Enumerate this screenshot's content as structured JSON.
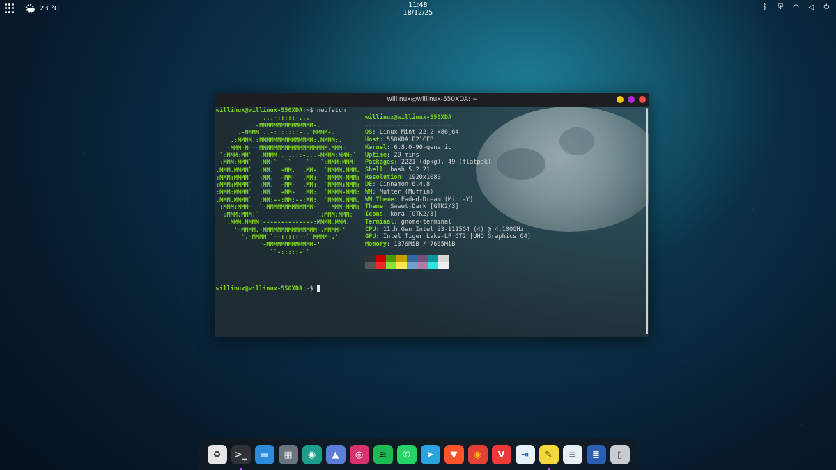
{
  "topbar": {
    "weather": {
      "icon": "partly-cloudy-icon",
      "temperature": "23 °C"
    },
    "clock": {
      "time": "11:48",
      "date": "18/12/25"
    },
    "tray": [
      {
        "name": "bluetooth-icon",
        "glyph": "ᛒ"
      },
      {
        "name": "shield-icon",
        "glyph": "⛨"
      },
      {
        "name": "wifi-icon",
        "glyph": "◠"
      },
      {
        "name": "volume-icon",
        "glyph": "◁"
      },
      {
        "name": "power-icon",
        "glyph": "⏻"
      }
    ]
  },
  "terminal": {
    "title": "willinux@willinux-550XDA: ~",
    "prompt_user": "willinux@willinux-550XDA",
    "prompt_suffix": ":~$ ",
    "command": "neofetch",
    "ascii_art": [
      "             ...-:::::-...",
      "          .-MMMMMMMMMMMMMMM-.",
      "      .-MMMM`..-:::::::-..`MMMM-.",
      "    .:MMMM.:MMMMMMMMMMMMMMM:.MMMM:.",
      "   -MMM-M---MMMMMMMMMMMMMMMMMMM.MMM-",
      " `:MMM:MM`  :MMMM:....::-...-MMMM:MMM:`",
      " :MMM:MMM`  :MM:`  ``    ``  `:MMM:MMM:",
      ".MMM.MMMM`  :MM.  -MM.  .MM-  `MMMM.MMM.",
      ":MMM:MMMM`  :MM.  -MM-  .MM:  `MMMM-MMM:",
      ":MMM:MMMM`  :MM.  -MM-  .MM:  `MMMM:MMM:",
      ":MMM:MMMM`  :MM.  -MM-  .MM:  `MMMM-MMM:",
      ".MMM.MMMM`  :MM:--:MM:--:MM:  `MMMM.MMM.",
      " :MMM:MMM-  `-MMMMMMMMMMMMM-`  -MMM-MMM:",
      "  :MMM:MMM:`                `:MMM:MMM:",
      "   .MMM.MMMM:--------------:MMMM.MMM.",
      "     '-MMMM.-MMMMMMMMMMMMMMM-.MMMM-'",
      "       '.-MMMM``--:::::--``MMMM-.'",
      "            '-MMMMMMMMMMMMM-'",
      "               ``-:::::-``"
    ],
    "info_header": "willinux@willinux-550XDA",
    "info_separator": "------------------------",
    "info": [
      {
        "key": "OS",
        "value": "Linux Mint 22.2 x86_64"
      },
      {
        "key": "Host",
        "value": "550XDA P21CFB"
      },
      {
        "key": "Kernel",
        "value": "6.8.0-90-generic"
      },
      {
        "key": "Uptime",
        "value": "29 mins"
      },
      {
        "key": "Packages",
        "value": "2221 (dpkg), 49 (flatpak)"
      },
      {
        "key": "Shell",
        "value": "bash 5.2.21"
      },
      {
        "key": "Resolution",
        "value": "1920x1080"
      },
      {
        "key": "DE",
        "value": "Cinnamon 6.4.8"
      },
      {
        "key": "WM",
        "value": "Mutter (Muffin)"
      },
      {
        "key": "WM Theme",
        "value": "Faded-Dream (Mint-Y)"
      },
      {
        "key": "Theme",
        "value": "Sweet-Dark [GTK2/3]"
      },
      {
        "key": "Icons",
        "value": "kora [GTK2/3]"
      },
      {
        "key": "Terminal",
        "value": "gnome-terminal"
      },
      {
        "key": "CPU",
        "value": "11th Gen Intel i3-1115G4 (4) @ 4.100GHz"
      },
      {
        "key": "GPU",
        "value": "Intel Tiger Lake-LP GT2 [UHD Graphics G4]"
      },
      {
        "key": "Memory",
        "value": "1376MiB / 7665MiB"
      }
    ],
    "palette": [
      "#2e3436",
      "#cc0000",
      "#4e9a06",
      "#c4a000",
      "#3465a4",
      "#75507b",
      "#06989a",
      "#d3d7cf",
      "#555753",
      "#ef2929",
      "#8ae234",
      "#fce94f",
      "#729fcf",
      "#ad7fa8",
      "#34e2e2",
      "#eeeeec"
    ]
  },
  "dock": [
    {
      "name": "trash-icon",
      "glyph": "♻",
      "bg": "#e6e6e6",
      "fg": "#444",
      "running": false
    },
    {
      "name": "terminal-icon",
      "glyph": ">_",
      "bg": "#2f3338",
      "fg": "#ddd",
      "running": true
    },
    {
      "name": "files-icon",
      "glyph": "▬",
      "bg": "#2f8bd9",
      "fg": "#9fd1ff",
      "running": false
    },
    {
      "name": "calculator-icon",
      "glyph": "▦",
      "bg": "#6a7480",
      "fg": "#e0e0e0",
      "running": false
    },
    {
      "name": "camera-icon",
      "glyph": "◉",
      "bg": "#1e9e8a",
      "fg": "#fff",
      "running": false
    },
    {
      "name": "image-viewer-icon",
      "glyph": "▲",
      "bg": "#5b7fd6",
      "fg": "#fff",
      "running": false
    },
    {
      "name": "instagram-icon",
      "glyph": "◎",
      "bg": "#d6336c",
      "fg": "#fff",
      "running": false
    },
    {
      "name": "spotify-icon",
      "glyph": "≋",
      "bg": "#1db954",
      "fg": "#111",
      "running": false
    },
    {
      "name": "whatsapp-icon",
      "glyph": "✆",
      "bg": "#25d366",
      "fg": "#fff",
      "running": false
    },
    {
      "name": "telegram-icon",
      "glyph": "➤",
      "bg": "#2aa3de",
      "fg": "#fff",
      "running": false
    },
    {
      "name": "brave-icon",
      "glyph": "▼",
      "bg": "#fb542b",
      "fg": "#fff",
      "running": false
    },
    {
      "name": "chrome-icon",
      "glyph": "◉",
      "bg": "#e34133",
      "fg": "#fbbc05",
      "running": false
    },
    {
      "name": "vivaldi-icon",
      "glyph": "V",
      "bg": "#ef3939",
      "fg": "#fff",
      "running": false
    },
    {
      "name": "remote-desktop-icon",
      "glyph": "⇥",
      "bg": "#e8f0f8",
      "fg": "#2b6cb0",
      "running": false
    },
    {
      "name": "sticky-notes-icon",
      "glyph": "✎",
      "bg": "#f6d83b",
      "fg": "#6b5a00",
      "running": true
    },
    {
      "name": "text-editor-icon",
      "glyph": "≡",
      "bg": "#e9eef4",
      "fg": "#6a7a8a",
      "running": false
    },
    {
      "name": "word-processor-icon",
      "glyph": "≣",
      "bg": "#2b5fb3",
      "fg": "#fff",
      "running": false
    },
    {
      "name": "workspace-switcher-icon",
      "glyph": "▯",
      "bg": "#c9ccd1",
      "fg": "#444",
      "running": false
    }
  ]
}
